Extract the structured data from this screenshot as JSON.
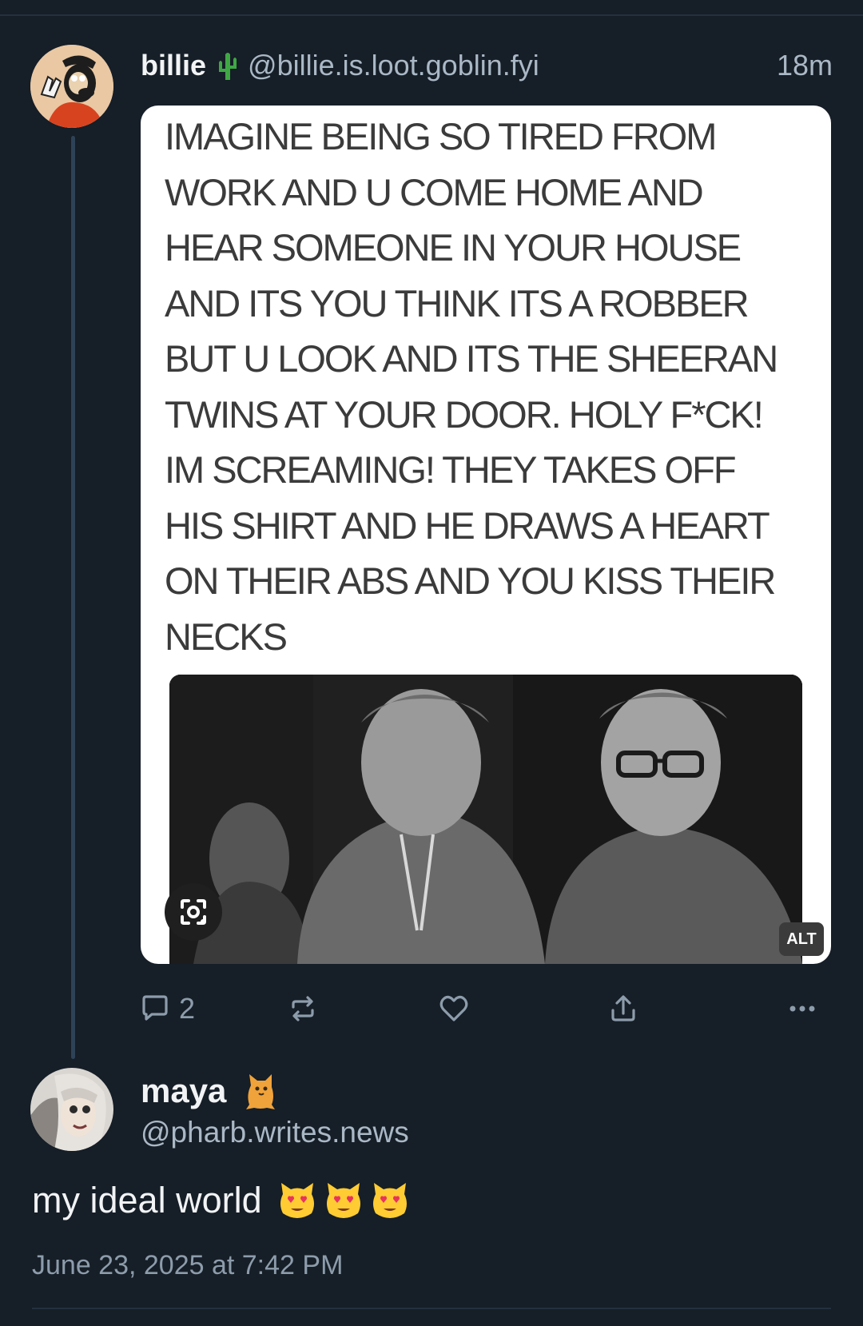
{
  "post": {
    "author_name": "billie",
    "author_emoji": "cactus-icon",
    "author_handle": "@billie.is.loot.goblin.fyi",
    "time": "18m",
    "image_text": "IMAGINE BEING SO TIRED FROM\nWORK AND U COME HOME AND\nHEAR SOMEONE IN YOUR HOUSE\nAND ITS YOU THINK ITS A ROBBER\nBUT U LOOK AND ITS THE SHEERAN\nTWINS AT YOUR DOOR. HOLY F*CK!\nIM SCREAMING! THEY TAKES OFF\nHIS SHIRT AND HE DRAWS A HEART\nON THEIR ABS AND YOU KISS THEIR\nNECKS",
    "alt_badge": "ALT",
    "reply_count": "2"
  },
  "actions": {
    "reply_icon": "speech-bubble-icon",
    "repost_icon": "repost-icon",
    "like_icon": "heart-icon",
    "share_icon": "share-icon",
    "more_icon": "more-dots-icon"
  },
  "reply": {
    "author_name": "maya",
    "author_emoji": "cat-icon",
    "author_handle": "@pharb.writes.news",
    "text": "my ideal world",
    "emojis": [
      "heart-eyes-cat-icon",
      "heart-eyes-cat-icon",
      "heart-eyes-cat-icon"
    ],
    "date": "June 23, 2025 at 7:42 PM"
  },
  "colors": {
    "background": "#161e27",
    "thread_line": "#2e4257",
    "muted_text": "#8d9cab",
    "primary_text": "#f1f3f5"
  }
}
